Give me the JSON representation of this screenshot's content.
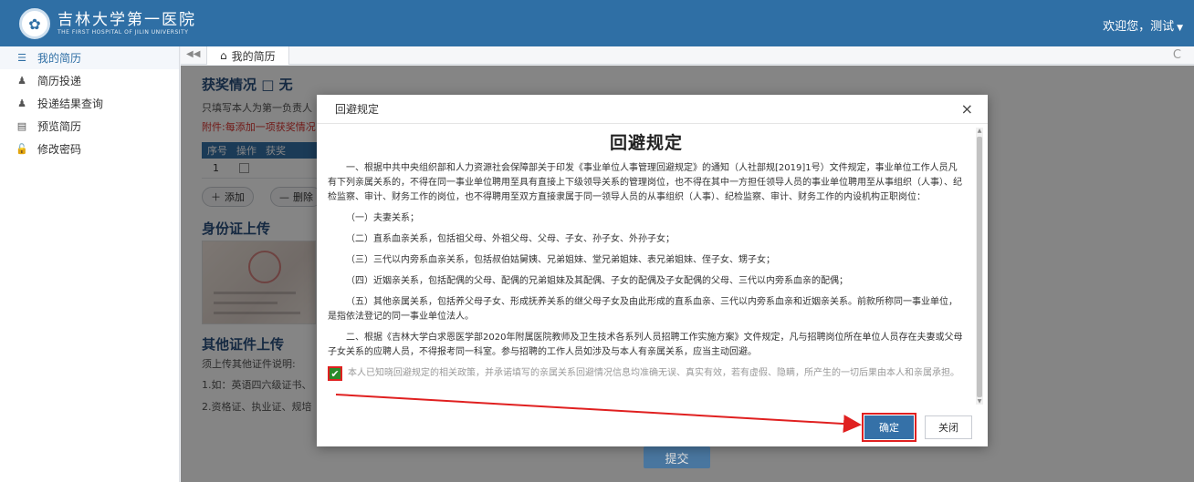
{
  "header": {
    "logo_cn": "吉林大学第一医院",
    "logo_en": "THE FIRST HOSPITAL OF JILIN UNIVERSITY",
    "welcome": "欢迎您，测试"
  },
  "sidebar": {
    "items": [
      {
        "label": "我的简历",
        "icon": "list-icon"
      },
      {
        "label": "简历投递",
        "icon": "user-icon"
      },
      {
        "label": "投递结果查询",
        "icon": "user-icon"
      },
      {
        "label": "预览简历",
        "icon": "document-icon"
      },
      {
        "label": "修改密码",
        "icon": "unlock-icon"
      }
    ]
  },
  "tabs": {
    "collapse": "◀◀",
    "active_tab": "我的简历",
    "refresh": "C"
  },
  "content": {
    "awards_title": "获奖情况 □ 无",
    "awards_note": "只填写本人为第一负责人",
    "awards_red_note": "附件:每添加一项获奖情况",
    "table_header": [
      "序号",
      "操作",
      "获奖"
    ],
    "row_index": "1",
    "add_label": "添加",
    "delete_label": "删除",
    "id_upload_title": "身份证上传",
    "other_cert_title": "其他证件上传",
    "other_cert_note": "须上传其他证件说明:",
    "other_cert_item1": "1.如：英语四六级证书、",
    "other_cert_item2": "2.资格证、执业证、规培",
    "submit_label": "提交"
  },
  "modal": {
    "header_title": "回避规定",
    "close_glyph": "×",
    "title": "回避规定",
    "paragraphs": [
      "一、根据中共中央组织部和人力资源社会保障部关于印发《事业单位人事管理回避规定》的通知（人社部规[2019]1号）文件规定，事业单位工作人员凡有下列亲属关系的，不得在同一事业单位聘用至具有直接上下级领导关系的管理岗位，也不得在其中一方担任领导人员的事业单位聘用至从事组织（人事）、纪检监察、审计、财务工作的岗位，也不得聘用至双方直接隶属于同一领导人员的从事组织（人事）、纪检监察、审计、财务工作的内设机构正职岗位：",
      "（一）夫妻关系；",
      "（二）直系血亲关系，包括祖父母、外祖父母、父母、子女、孙子女、外孙子女；",
      "（三）三代以内旁系血亲关系，包括叔伯姑舅姨、兄弟姐妹、堂兄弟姐妹、表兄弟姐妹、侄子女、甥子女；",
      "（四）近姻亲关系，包括配偶的父母、配偶的兄弟姐妹及其配偶、子女的配偶及子女配偶的父母、三代以内旁系血亲的配偶；",
      "（五）其他亲属关系，包括养父母子女、形成抚养关系的继父母子女及由此形成的直系血亲、三代以内旁系血亲和近姻亲关系。前款所称同一事业单位，是指依法登记的同一事业单位法人。",
      "二、根据《吉林大学白求恩医学部2020年附属医院教师及卫生技术各系列人员招聘工作实施方案》文件规定，凡与招聘岗位所在单位人员存在夫妻或父母子女关系的应聘人员，不得报考同一科室。参与招聘的工作人员如涉及与本人有亲属关系，应当主动回避。"
    ],
    "agree_text": "本人已知晓回避规定的相关政策，并承诺填写的亲属关系回避情况信息均准确无误、真实有效，若有虚假、隐瞒，所产生的一切后果由本人和亲属承担。",
    "agree_checked": true,
    "ok_label": "确定",
    "close_label": "关闭",
    "highlight_color": "#e02020"
  }
}
